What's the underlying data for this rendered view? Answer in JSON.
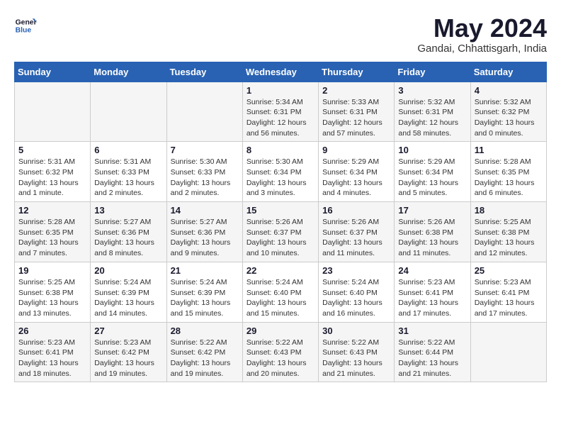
{
  "logo": {
    "line1": "General",
    "line2": "Blue"
  },
  "title": "May 2024",
  "location": "Gandai, Chhattisgarh, India",
  "days_header": [
    "Sunday",
    "Monday",
    "Tuesday",
    "Wednesday",
    "Thursday",
    "Friday",
    "Saturday"
  ],
  "weeks": [
    [
      {
        "num": "",
        "info": ""
      },
      {
        "num": "",
        "info": ""
      },
      {
        "num": "",
        "info": ""
      },
      {
        "num": "1",
        "info": "Sunrise: 5:34 AM\nSunset: 6:31 PM\nDaylight: 12 hours and 56 minutes."
      },
      {
        "num": "2",
        "info": "Sunrise: 5:33 AM\nSunset: 6:31 PM\nDaylight: 12 hours and 57 minutes."
      },
      {
        "num": "3",
        "info": "Sunrise: 5:32 AM\nSunset: 6:31 PM\nDaylight: 12 hours and 58 minutes."
      },
      {
        "num": "4",
        "info": "Sunrise: 5:32 AM\nSunset: 6:32 PM\nDaylight: 13 hours and 0 minutes."
      }
    ],
    [
      {
        "num": "5",
        "info": "Sunrise: 5:31 AM\nSunset: 6:32 PM\nDaylight: 13 hours and 1 minute."
      },
      {
        "num": "6",
        "info": "Sunrise: 5:31 AM\nSunset: 6:33 PM\nDaylight: 13 hours and 2 minutes."
      },
      {
        "num": "7",
        "info": "Sunrise: 5:30 AM\nSunset: 6:33 PM\nDaylight: 13 hours and 2 minutes."
      },
      {
        "num": "8",
        "info": "Sunrise: 5:30 AM\nSunset: 6:34 PM\nDaylight: 13 hours and 3 minutes."
      },
      {
        "num": "9",
        "info": "Sunrise: 5:29 AM\nSunset: 6:34 PM\nDaylight: 13 hours and 4 minutes."
      },
      {
        "num": "10",
        "info": "Sunrise: 5:29 AM\nSunset: 6:34 PM\nDaylight: 13 hours and 5 minutes."
      },
      {
        "num": "11",
        "info": "Sunrise: 5:28 AM\nSunset: 6:35 PM\nDaylight: 13 hours and 6 minutes."
      }
    ],
    [
      {
        "num": "12",
        "info": "Sunrise: 5:28 AM\nSunset: 6:35 PM\nDaylight: 13 hours and 7 minutes."
      },
      {
        "num": "13",
        "info": "Sunrise: 5:27 AM\nSunset: 6:36 PM\nDaylight: 13 hours and 8 minutes."
      },
      {
        "num": "14",
        "info": "Sunrise: 5:27 AM\nSunset: 6:36 PM\nDaylight: 13 hours and 9 minutes."
      },
      {
        "num": "15",
        "info": "Sunrise: 5:26 AM\nSunset: 6:37 PM\nDaylight: 13 hours and 10 minutes."
      },
      {
        "num": "16",
        "info": "Sunrise: 5:26 AM\nSunset: 6:37 PM\nDaylight: 13 hours and 11 minutes."
      },
      {
        "num": "17",
        "info": "Sunrise: 5:26 AM\nSunset: 6:38 PM\nDaylight: 13 hours and 11 minutes."
      },
      {
        "num": "18",
        "info": "Sunrise: 5:25 AM\nSunset: 6:38 PM\nDaylight: 13 hours and 12 minutes."
      }
    ],
    [
      {
        "num": "19",
        "info": "Sunrise: 5:25 AM\nSunset: 6:38 PM\nDaylight: 13 hours and 13 minutes."
      },
      {
        "num": "20",
        "info": "Sunrise: 5:24 AM\nSunset: 6:39 PM\nDaylight: 13 hours and 14 minutes."
      },
      {
        "num": "21",
        "info": "Sunrise: 5:24 AM\nSunset: 6:39 PM\nDaylight: 13 hours and 15 minutes."
      },
      {
        "num": "22",
        "info": "Sunrise: 5:24 AM\nSunset: 6:40 PM\nDaylight: 13 hours and 15 minutes."
      },
      {
        "num": "23",
        "info": "Sunrise: 5:24 AM\nSunset: 6:40 PM\nDaylight: 13 hours and 16 minutes."
      },
      {
        "num": "24",
        "info": "Sunrise: 5:23 AM\nSunset: 6:41 PM\nDaylight: 13 hours and 17 minutes."
      },
      {
        "num": "25",
        "info": "Sunrise: 5:23 AM\nSunset: 6:41 PM\nDaylight: 13 hours and 17 minutes."
      }
    ],
    [
      {
        "num": "26",
        "info": "Sunrise: 5:23 AM\nSunset: 6:41 PM\nDaylight: 13 hours and 18 minutes."
      },
      {
        "num": "27",
        "info": "Sunrise: 5:23 AM\nSunset: 6:42 PM\nDaylight: 13 hours and 19 minutes."
      },
      {
        "num": "28",
        "info": "Sunrise: 5:22 AM\nSunset: 6:42 PM\nDaylight: 13 hours and 19 minutes."
      },
      {
        "num": "29",
        "info": "Sunrise: 5:22 AM\nSunset: 6:43 PM\nDaylight: 13 hours and 20 minutes."
      },
      {
        "num": "30",
        "info": "Sunrise: 5:22 AM\nSunset: 6:43 PM\nDaylight: 13 hours and 21 minutes."
      },
      {
        "num": "31",
        "info": "Sunrise: 5:22 AM\nSunset: 6:44 PM\nDaylight: 13 hours and 21 minutes."
      },
      {
        "num": "",
        "info": ""
      }
    ]
  ]
}
